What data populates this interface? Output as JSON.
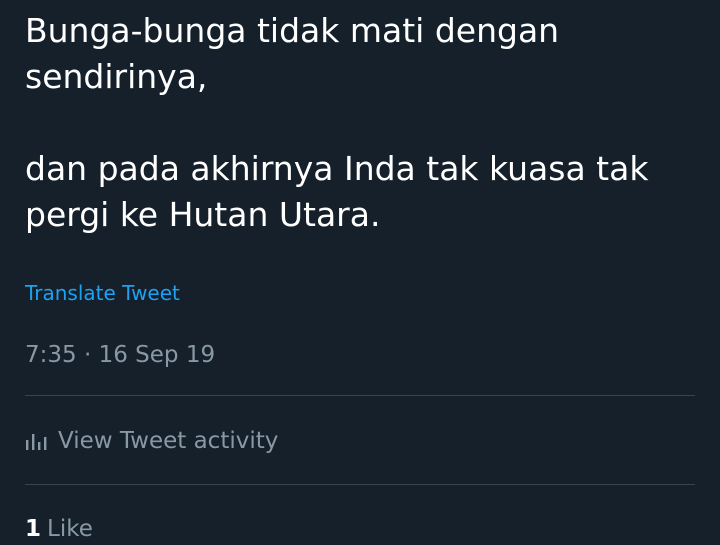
{
  "tweet": {
    "text": "Bunga-bunga tidak mati dengan\nsendirinya,\n\ndan pada akhirnya Inda tak kuasa tak\npergi ke Hutan Utara.",
    "translate_label": "Translate Tweet",
    "timestamp": "7:35 · 16 Sep 19"
  },
  "activity": {
    "label": "View Tweet activity",
    "icon": "bar-chart-icon"
  },
  "engagement": {
    "like_count": "1",
    "like_label": "Like"
  },
  "colors": {
    "background": "#15202b",
    "text": "#ffffff",
    "secondary_text": "#8899a6",
    "link": "#1da1f2",
    "divider": "#38444d"
  }
}
